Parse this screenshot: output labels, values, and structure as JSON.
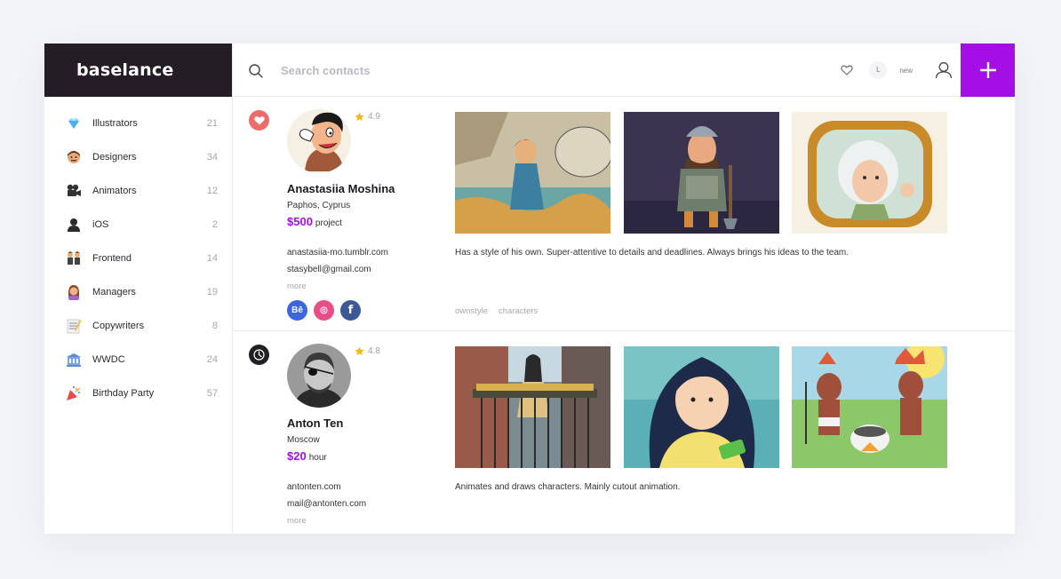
{
  "brand": "baselance",
  "search": {
    "placeholder": "Search contacts"
  },
  "top": {
    "l_label": "L",
    "new_label": "new"
  },
  "colors": {
    "accent": "#a40fe5",
    "brand_bg": "#241d26",
    "heart_badge": "#ec6b6b",
    "clock_badge": "#1f1f24"
  },
  "categories": [
    {
      "label": "Illustrators",
      "count": "21",
      "icon": "diamond-icon"
    },
    {
      "label": "Designers",
      "count": "34",
      "icon": "face-icon"
    },
    {
      "label": "Animators",
      "count": "12",
      "icon": "movie-camera-icon"
    },
    {
      "label": "iOS",
      "count": "2",
      "icon": "silhouette-icon"
    },
    {
      "label": "Frontend",
      "count": "14",
      "icon": "twins-icon"
    },
    {
      "label": "Managers",
      "count": "19",
      "icon": "woman-icon"
    },
    {
      "label": "Copywriters",
      "count": "8",
      "icon": "memo-icon"
    },
    {
      "label": "WWDC",
      "count": "24",
      "icon": "building-icon"
    },
    {
      "label": "Birthday Party",
      "count": "57",
      "icon": "party-popper-icon"
    }
  ],
  "contacts": [
    {
      "badge": "heart-icon",
      "rating": "4.9",
      "name": "Anastasiia Moshina",
      "location": "Paphos, Cyprus",
      "price": "$500",
      "unit": "project",
      "link1": "anastasiia-mo.tumblr.com",
      "link2": "stasybell@gmail.com",
      "more": "more",
      "socials": [
        "Bē",
        "◎",
        "f"
      ],
      "description": "Has a style of his own. Super-attentive to details and deadlines. Always brings his ideas to the team.",
      "tags": [
        "ownstyle",
        "characters"
      ]
    },
    {
      "badge": "clock-icon",
      "rating": "4.8",
      "name": "Anton Ten",
      "location": "Moscow",
      "price": "$20",
      "unit": "hour",
      "link1": "antonten.com",
      "link2": "mail@antonten.com",
      "more": "more",
      "description": "Animates and draws characters. Mainly cutout animation."
    }
  ]
}
